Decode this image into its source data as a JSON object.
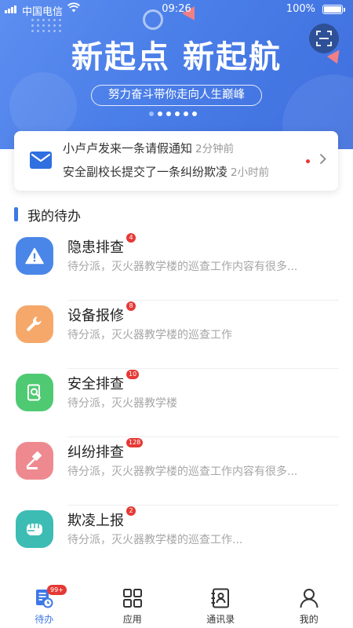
{
  "status_bar": {
    "carrier": "中国电信",
    "time": "09:26",
    "battery": "100%"
  },
  "banner": {
    "title": "新起点 新起航",
    "subtitle": "努力奋斗带你走向人生巅峰",
    "slides": 6,
    "active_slide": 0
  },
  "notice": {
    "items": [
      {
        "text": "小卢卢发来一条请假通知",
        "ago": "2分钟前"
      },
      {
        "text": "安全副校长提交了一条纠纷欺凌",
        "ago": "2小时前"
      }
    ]
  },
  "section": {
    "title": "我的待办"
  },
  "todos": [
    {
      "title": "隐患排查",
      "badge": "4",
      "desc": "待分派，灭火器教学楼的巡查工作内容有很多...",
      "color": "#4a86e8",
      "icon": "warning-icon"
    },
    {
      "title": "设备报修",
      "badge": "8",
      "desc": "待分派，灭火器教学楼的巡查工作",
      "color": "#f5a86a",
      "icon": "wrench-icon"
    },
    {
      "title": "安全排查",
      "badge": "10",
      "desc": "待分派，灭火器教学楼",
      "color": "#4fca72",
      "icon": "inspect-icon"
    },
    {
      "title": "纠纷排查",
      "badge": "128",
      "desc": "待分派，灭火器教学楼的巡查工作内容有很多...",
      "color": "#ee8a8f",
      "icon": "gavel-icon"
    },
    {
      "title": "欺凌上报",
      "badge": "2",
      "desc": "待分派，灭火器教学楼的巡查工作...",
      "color": "#3dbcb4",
      "icon": "fist-icon"
    }
  ],
  "tabbar": {
    "tabs": [
      {
        "label": "待办",
        "icon": "todo-icon",
        "badge": "99+",
        "active": true
      },
      {
        "label": "应用",
        "icon": "grid-icon",
        "active": false
      },
      {
        "label": "通讯录",
        "icon": "contacts-icon",
        "active": false
      },
      {
        "label": "我的",
        "icon": "user-icon",
        "active": false
      }
    ]
  },
  "colors": {
    "primary": "#3d78e6",
    "badge": "#e53935",
    "banner": "#4a7ee8"
  }
}
